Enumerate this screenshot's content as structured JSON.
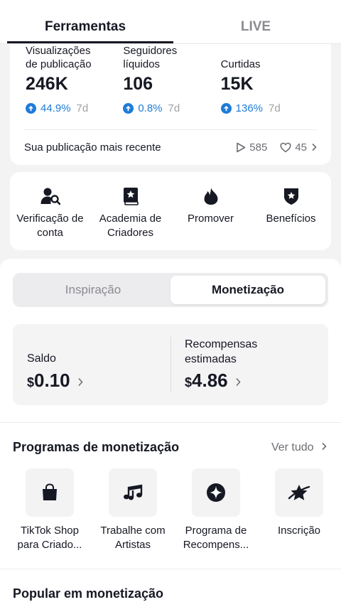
{
  "top_tabs": [
    {
      "label": "Ferramentas",
      "active": true
    },
    {
      "label": "LIVE",
      "active": false
    }
  ],
  "stats": [
    {
      "label_line1": "Visualizações",
      "label_line2": "de publicação",
      "value": "246K",
      "change": "44.9%",
      "period": "7d"
    },
    {
      "label_line1": "Seguidores",
      "label_line2": "líquidos",
      "value": "106",
      "change": "0.8%",
      "period": "7d"
    },
    {
      "label_line1": "",
      "label_line2": "Curtidas",
      "value": "15K",
      "change": "136%",
      "period": "7d"
    }
  ],
  "recent": {
    "label": "Sua publicação mais recente",
    "plays": "585",
    "likes": "45"
  },
  "tools": [
    {
      "icon": "account-verify-icon",
      "line1": "Verificação de",
      "line2": "conta"
    },
    {
      "icon": "academy-book-icon",
      "line1": "Academia de",
      "line2": "Criadores"
    },
    {
      "icon": "flame-icon",
      "line1": "Promover",
      "line2": ""
    },
    {
      "icon": "badge-star-icon",
      "line1": "Benefícios",
      "line2": ""
    }
  ],
  "segments": [
    {
      "label": "Inspiração",
      "active": false
    },
    {
      "label": "Monetização",
      "active": true
    }
  ],
  "balance": {
    "saldo_label": "Saldo",
    "saldo_currency": "$",
    "saldo_value": "0.10",
    "reward_label_line1": "Recompensas",
    "reward_label_line2": "estimadas",
    "reward_currency": "$",
    "reward_value": "4.86"
  },
  "programs": {
    "title": "Programas de monetização",
    "see_all": "Ver tudo",
    "items": [
      {
        "icon": "shopping-bag-icon",
        "line1": "TikTok Shop",
        "line2": "para Criado..."
      },
      {
        "icon": "music-notes-icon",
        "line1": "Trabalhe com",
        "line2": "Artistas"
      },
      {
        "icon": "star-circle-icon",
        "line1": "Programa de",
        "line2": "Recompens..."
      },
      {
        "icon": "planet-star-icon",
        "line1": "Inscrição",
        "line2": ""
      }
    ]
  },
  "popular": {
    "title": "Popular em monetização"
  },
  "colors": {
    "accent_blue": "#1e7bd8",
    "text": "#161823",
    "muted": "#8a8b91"
  }
}
